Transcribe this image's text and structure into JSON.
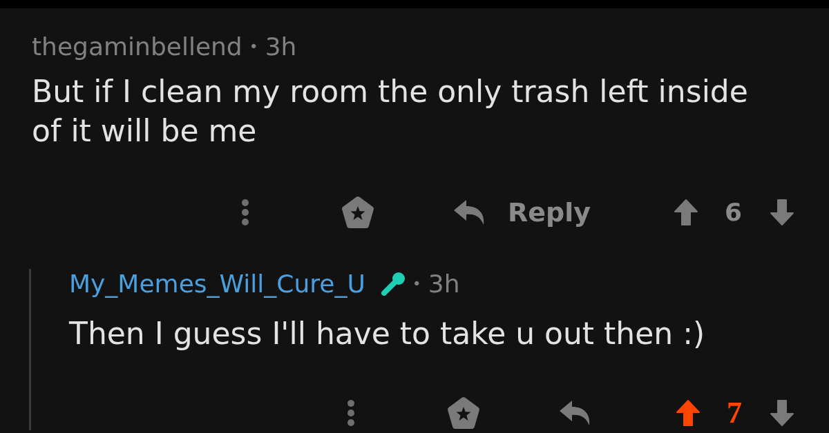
{
  "comments": [
    {
      "author": "thegaminbellend",
      "is_submitter": false,
      "has_badge": false,
      "separator": "•",
      "time": "3h",
      "body": "But if I clean my room the only trash left inside of it will be me",
      "reply_label": "Reply",
      "score": "6",
      "upvoted": false,
      "downvoted": false,
      "children": [
        {
          "author": "My_Memes_Will_Cure_U",
          "is_submitter": true,
          "has_badge": true,
          "separator": "•",
          "time": "3h",
          "body": "Then I guess I'll have to take u out then :)",
          "score": "7",
          "upvoted": true,
          "downvoted": false
        }
      ]
    }
  ]
}
